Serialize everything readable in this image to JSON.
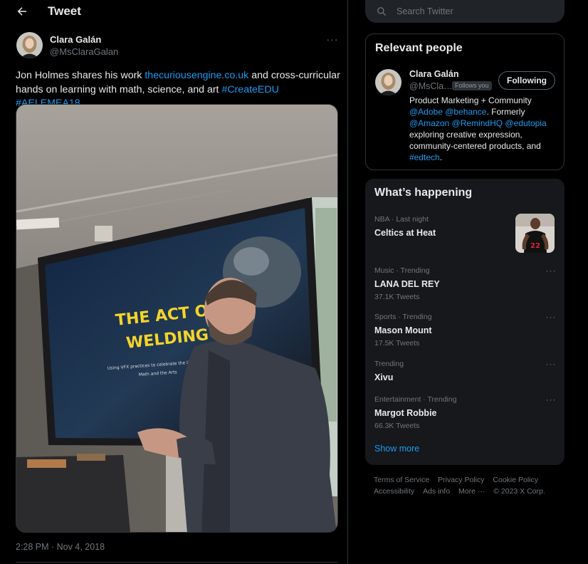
{
  "header": {
    "title": "Tweet",
    "back_icon": "arrow-left-icon"
  },
  "tweet": {
    "author": {
      "name": "Clara Galán",
      "handle": "@MsClaraGalan"
    },
    "more_icon": "more-horizontal-icon",
    "text_parts": [
      {
        "text": "Jon Holmes shares his work ",
        "link": false
      },
      {
        "text": "thecuriousengine.co.uk",
        "link": true
      },
      {
        "text": " and cross-curricular hands on learning with math, science, and art ",
        "link": false
      },
      {
        "text": "#CreateEDU",
        "link": true
      },
      {
        "text": " ",
        "link": false
      },
      {
        "text": "#AELEMEA18",
        "link": true
      }
    ],
    "media": {
      "slide_title_line1": "THE ACT OF",
      "slide_title_line2": "WELDING",
      "slide_subtitle_line1": "Using VFX practices to celebrate the link between Science",
      "slide_subtitle_line2": "Math and the Arts"
    },
    "timestamp": "2:28 PM · Nov 4, 2018"
  },
  "search": {
    "placeholder": "Search Twitter",
    "icon": "search-icon"
  },
  "relevant_people": {
    "title": "Relevant people",
    "person": {
      "name": "Clara Galán",
      "handle": "@MsCla…",
      "badge": "Follows you",
      "button_label": "Following",
      "bio_parts": [
        {
          "text": "Product Marketing + Community ",
          "link": false
        },
        {
          "text": "@Adobe",
          "link": true
        },
        {
          "text": " ",
          "link": false
        },
        {
          "text": "@behance",
          "link": true
        },
        {
          "text": ". Formerly ",
          "link": false
        },
        {
          "text": "@Amazon",
          "link": true
        },
        {
          "text": " ",
          "link": false
        },
        {
          "text": "@RemindHQ",
          "link": true
        },
        {
          "text": " ",
          "link": false
        },
        {
          "text": "@edutopia",
          "link": true
        },
        {
          "text": " exploring creative expression, community-centered products, and ",
          "link": false
        },
        {
          "text": "#edtech",
          "link": true
        },
        {
          "text": ".",
          "link": false
        }
      ]
    }
  },
  "whats_happening": {
    "title": "What’s happening",
    "trends": [
      {
        "meta": "NBA · Last night",
        "title": "Celtics at Heat",
        "count": "",
        "has_thumb": true
      },
      {
        "meta": "Music · Trending",
        "title": "LANA DEL REY",
        "count": "37.1K Tweets",
        "has_thumb": false
      },
      {
        "meta": "Sports · Trending",
        "title": "Mason Mount",
        "count": "17.5K Tweets",
        "has_thumb": false
      },
      {
        "meta": "Trending",
        "title": "Xivu",
        "count": "",
        "has_thumb": false
      },
      {
        "meta": "Entertainment · Trending",
        "title": "Margot Robbie",
        "count": "66.3K Tweets",
        "has_thumb": false
      }
    ],
    "thumb_jersey_number": "22",
    "show_more": "Show more"
  },
  "footer": {
    "links": [
      "Terms of Service",
      "Privacy Policy",
      "Cookie Policy",
      "Accessibility",
      "Ads info",
      "More ···"
    ],
    "copyright": "© 2023 X Corp."
  },
  "colors": {
    "background": "#000000",
    "accent": "#1d9bf0",
    "text_primary": "#e7e9ea",
    "text_secondary": "#71767b",
    "card_bg": "#16181c",
    "border": "#2f3336"
  }
}
